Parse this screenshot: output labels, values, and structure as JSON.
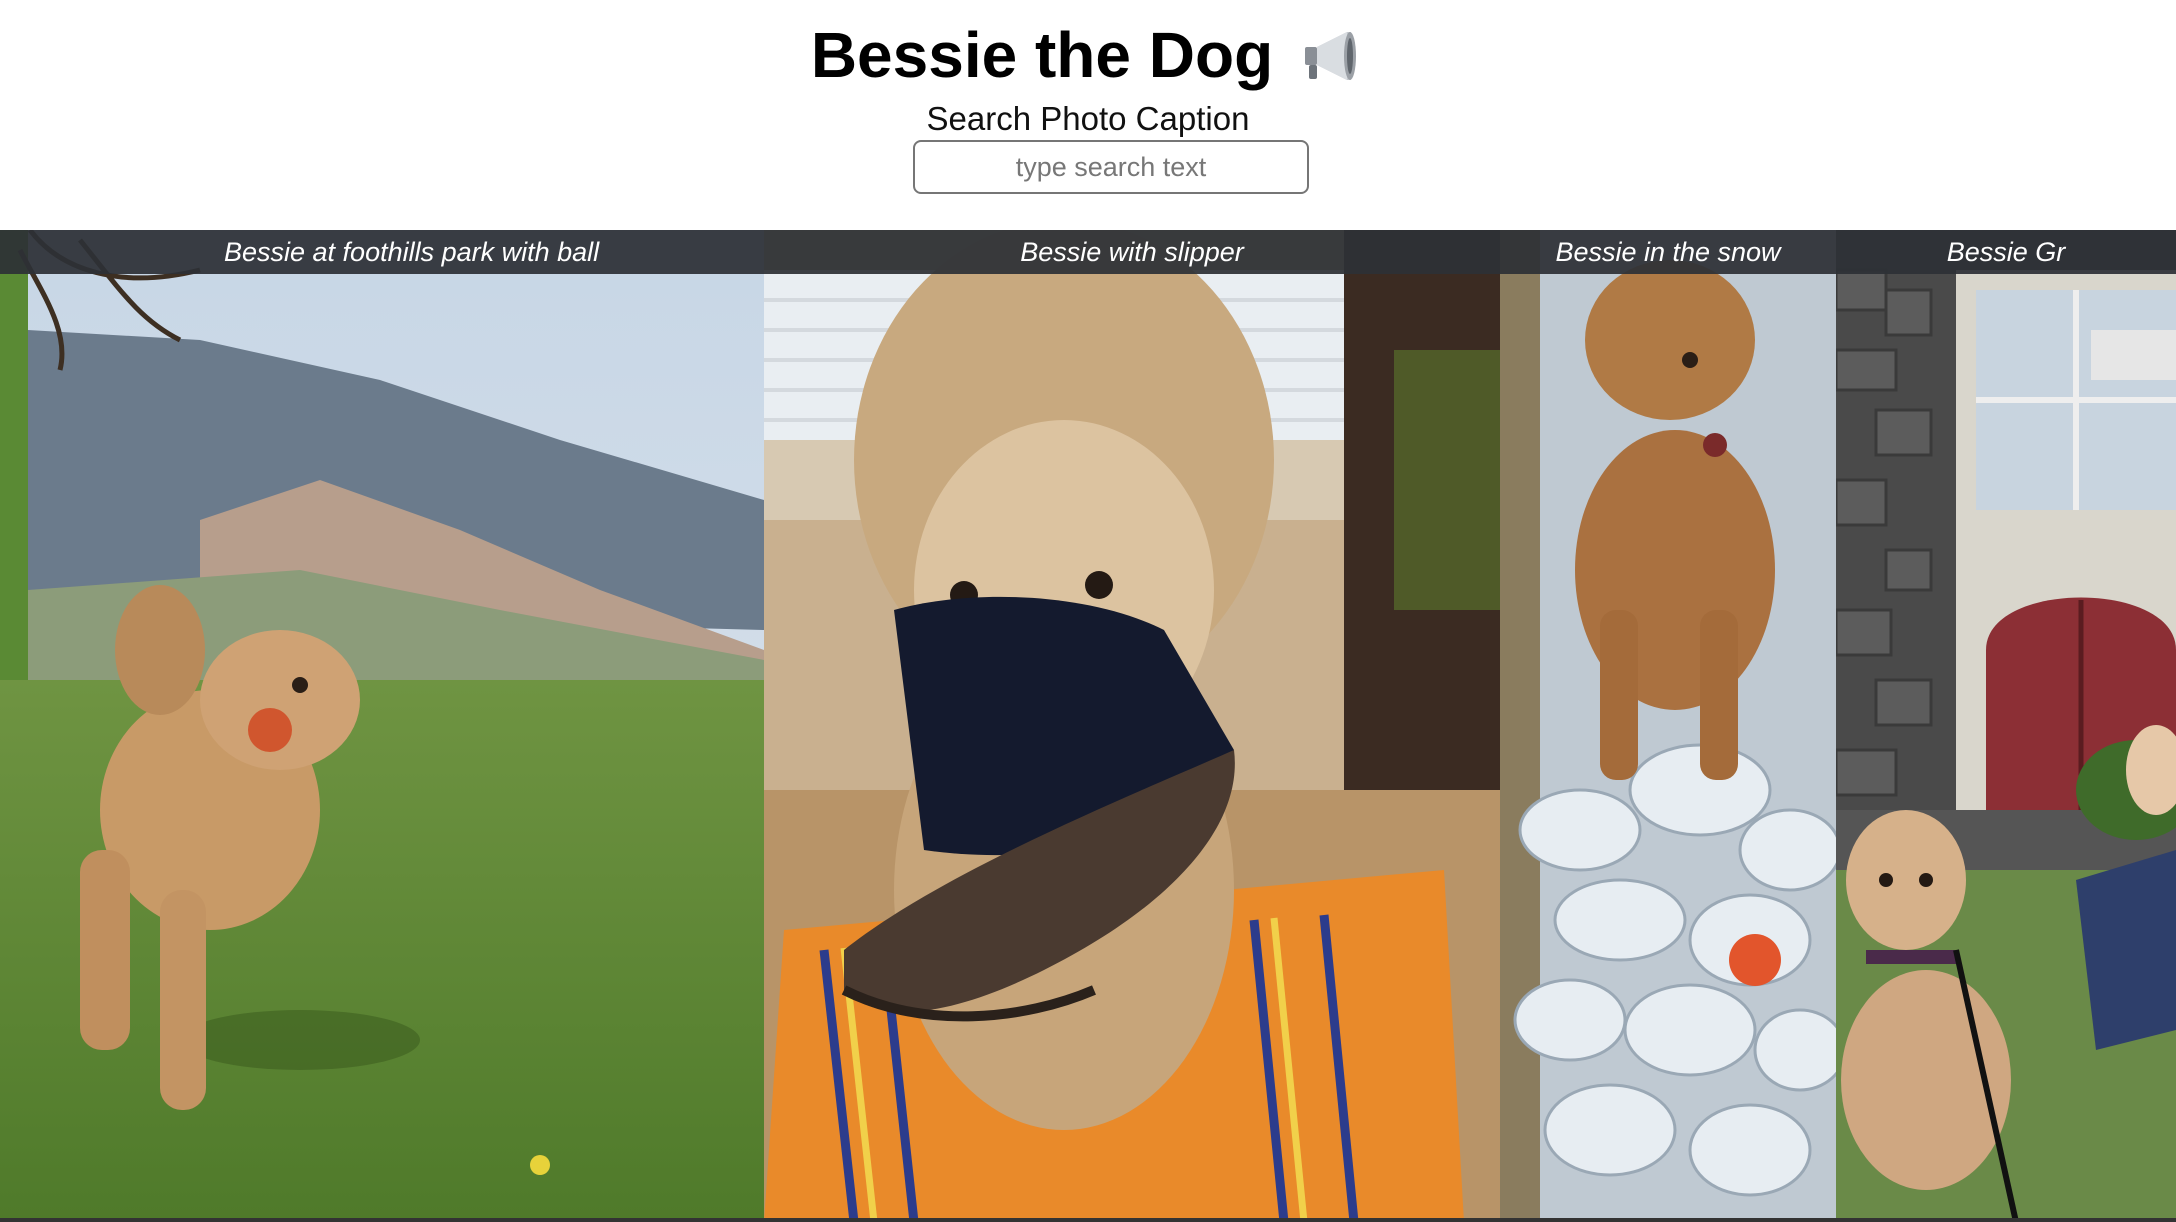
{
  "header": {
    "title": "Bessie the Dog",
    "title_icon": "megaphone-icon"
  },
  "search": {
    "label": "Search Photo Caption",
    "placeholder": "type search text",
    "value": ""
  },
  "gallery": {
    "photos": [
      {
        "caption": "Bessie at foothills park with ball",
        "subject": "dog running on grass with ball, mountains behind"
      },
      {
        "caption": "Bessie with slipper",
        "subject": "dog holding slipper in mouth on striped towel"
      },
      {
        "caption": "Bessie in the snow",
        "subject": "dog standing on snow pile with red ball"
      },
      {
        "caption": "Bessie Gr",
        "subject": "dog on leash with person in front of church door"
      }
    ]
  },
  "colors": {
    "caption_bar": "#2d3036",
    "gallery_background": "#3a3a3a",
    "input_border": "#767676"
  }
}
